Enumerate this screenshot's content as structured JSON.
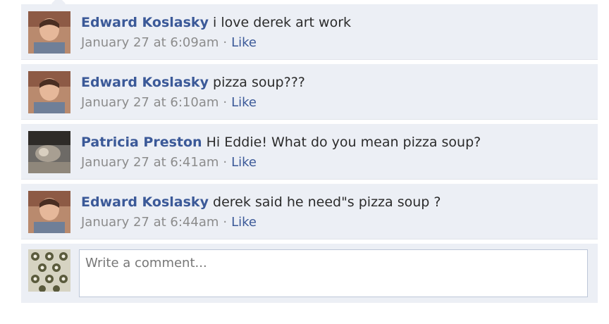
{
  "comments": [
    {
      "author": "Edward Koslasky",
      "text": "i love derek art work",
      "timestamp": "January 27 at 6:09am",
      "separator": "·",
      "like_label": "Like",
      "avatar_icon": "profile-photo-edward"
    },
    {
      "author": "Edward Koslasky",
      "text": "pizza soup???",
      "timestamp": "January 27 at 6:10am",
      "separator": "·",
      "like_label": "Like",
      "avatar_icon": "profile-photo-edward"
    },
    {
      "author": "Patricia Preston",
      "text": "Hi Eddie! What do you mean pizza soup?",
      "timestamp": "January 27 at 6:41am",
      "separator": "·",
      "like_label": "Like",
      "avatar_icon": "profile-photo-patricia"
    },
    {
      "author": "Edward Koslasky",
      "text": "derek said he need\"s pizza soup ?",
      "timestamp": "January 27 at 6:44am",
      "separator": "·",
      "like_label": "Like",
      "avatar_icon": "profile-photo-edward"
    }
  ],
  "composer": {
    "placeholder": "Write a comment...",
    "avatar_icon": "profile-photo-current-user"
  },
  "colors": {
    "author_link": "#3b5998",
    "background": "#eceff5",
    "meta_text": "#8c8c8c"
  }
}
